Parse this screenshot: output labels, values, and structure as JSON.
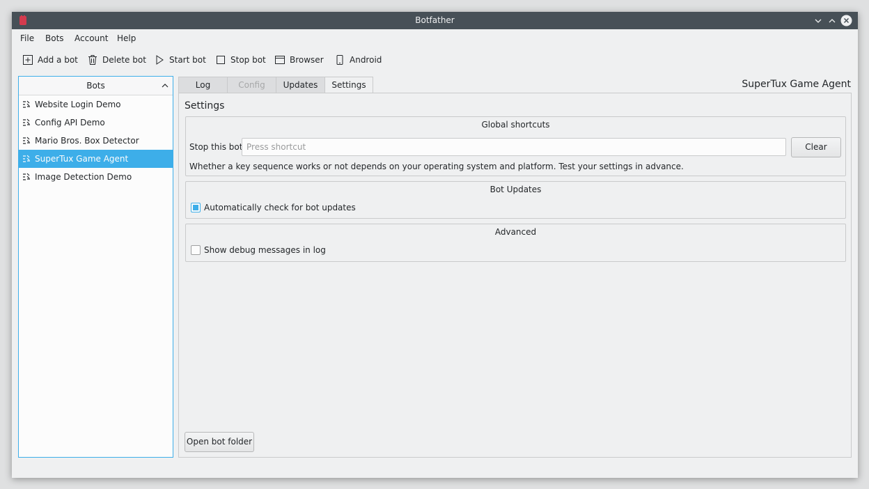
{
  "window": {
    "title": "Botfather"
  },
  "menu": [
    "File",
    "Bots",
    "Account",
    "Help"
  ],
  "toolbar": {
    "add": "Add a bot",
    "delete": "Delete bot",
    "start": "Start bot",
    "stop": "Stop bot",
    "browser": "Browser",
    "android": "Android"
  },
  "bots": {
    "header": "Bots",
    "items": [
      "Website Login Demo",
      "Config API Demo",
      "Mario Bros. Box Detector",
      "SuperTux Game Agent",
      "Image Detection Demo"
    ],
    "selected_index": 3
  },
  "tabs": [
    "Log",
    "Config",
    "Updates",
    "Settings"
  ],
  "active_tab": "Settings",
  "bot_name": "SuperTux Game Agent",
  "settings": {
    "heading": "Settings",
    "global_shortcuts": {
      "title": "Global shortcuts",
      "stop_label": "Stop this bot",
      "placeholder": "Press shortcut",
      "clear_label": "Clear",
      "note": "Whether a key sequence works or not depends on your operating system and platform. Test your settings in advance."
    },
    "bot_updates": {
      "title": "Bot Updates",
      "auto_check_label": "Automatically check for bot updates",
      "auto_check_checked": true
    },
    "advanced": {
      "title": "Advanced",
      "debug_label": "Show debug messages in log",
      "debug_checked": false
    },
    "open_folder_label": "Open bot folder"
  },
  "colors": {
    "accent": "#3daee9",
    "titlebar": "#475057",
    "background": "#eff0f1"
  }
}
